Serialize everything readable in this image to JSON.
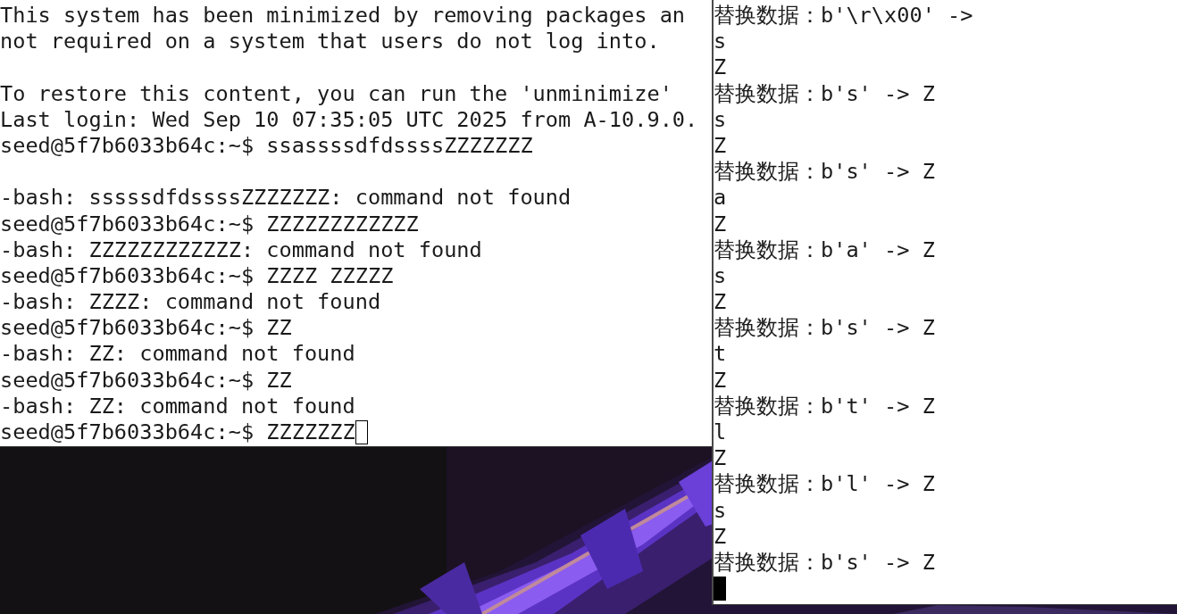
{
  "terminals": [
    {
      "focused": false,
      "lines": [
        {
          "kind": "text",
          "text": "This system has been minimized by removing packages an"
        },
        {
          "kind": "text",
          "text": "not required on a system that users do not log into."
        },
        {
          "kind": "blank"
        },
        {
          "kind": "text",
          "text": "To restore this content, you can run the 'unminimize'"
        },
        {
          "kind": "text",
          "text": "Last login: Wed Sep 10 07:35:05 UTC 2025 from A-10.9.0."
        },
        {
          "kind": "text",
          "text": "seed@5f7b6033b64c:~$ ssassssdfdssssZZZZZZZ"
        },
        {
          "kind": "blank"
        },
        {
          "kind": "text",
          "text": "-bash: sssssdfdssssZZZZZZZ: command not found"
        },
        {
          "kind": "text",
          "text": "seed@5f7b6033b64c:~$ ZZZZZZZZZZZZ"
        },
        {
          "kind": "text",
          "text": "-bash: ZZZZZZZZZZZZ: command not found"
        },
        {
          "kind": "text",
          "text": "seed@5f7b6033b64c:~$ ZZZZ ZZZZZ"
        },
        {
          "kind": "text",
          "text": "-bash: ZZZZ: command not found"
        },
        {
          "kind": "text",
          "text": "seed@5f7b6033b64c:~$ ZZ"
        },
        {
          "kind": "text",
          "text": "-bash: ZZ: command not found"
        },
        {
          "kind": "text",
          "text": "seed@5f7b6033b64c:~$ ZZ"
        },
        {
          "kind": "text",
          "text": "-bash: ZZ: command not found"
        },
        {
          "kind": "prompt",
          "text": "seed@5f7b6033b64c:~$ ZZZZZZZ"
        }
      ]
    },
    {
      "focused": true,
      "lines": [
        {
          "kind": "text",
          "text": "替换数据：b'\\r\\x00' ->"
        },
        {
          "kind": "text",
          "text": "s"
        },
        {
          "kind": "text",
          "text": "Z"
        },
        {
          "kind": "text",
          "text": "替换数据：b's' -> Z"
        },
        {
          "kind": "text",
          "text": "s"
        },
        {
          "kind": "text",
          "text": "Z"
        },
        {
          "kind": "text",
          "text": "替换数据：b's' -> Z"
        },
        {
          "kind": "text",
          "text": "a"
        },
        {
          "kind": "text",
          "text": "Z"
        },
        {
          "kind": "text",
          "text": "替换数据：b'a' -> Z"
        },
        {
          "kind": "text",
          "text": "s"
        },
        {
          "kind": "text",
          "text": "Z"
        },
        {
          "kind": "text",
          "text": "替换数据：b's' -> Z"
        },
        {
          "kind": "text",
          "text": "t"
        },
        {
          "kind": "text",
          "text": "Z"
        },
        {
          "kind": "text",
          "text": "替换数据：b't' -> Z"
        },
        {
          "kind": "text",
          "text": "l"
        },
        {
          "kind": "text",
          "text": "Z"
        },
        {
          "kind": "text",
          "text": "替换数据：b'l' -> Z"
        },
        {
          "kind": "text",
          "text": "s"
        },
        {
          "kind": "text",
          "text": "Z"
        },
        {
          "kind": "text",
          "text": "替换数据：b's' -> Z"
        },
        {
          "kind": "cursor"
        }
      ]
    }
  ]
}
